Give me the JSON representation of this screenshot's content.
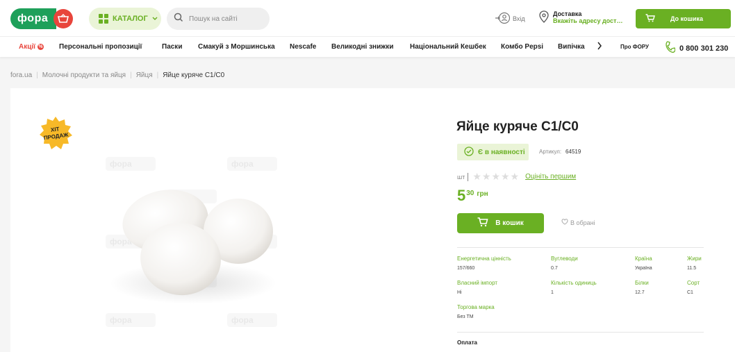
{
  "header": {
    "logo_text": "фора",
    "catalog_label": "КАТАЛОГ",
    "search_placeholder": "Пошук на сайті",
    "login_label": "Вхід",
    "delivery_title": "Доставка",
    "delivery_subtitle": "Вкажіть адресу доставки",
    "cart_label": "До кошика"
  },
  "nav": {
    "items": [
      "Акції",
      "Персональні пропозиції",
      "Паски",
      "Смакуй з Моршинська",
      "Nescafe",
      "Великодні знижки",
      "Національний Кешбек",
      "Комбо Pepsi",
      "Випічка"
    ],
    "about_label": "Про ФОРУ",
    "phone": "0 800 301 230"
  },
  "breadcrumb": [
    "fora.ua",
    "Молочні продукти та яйця",
    "Яйця",
    "Яйце куряче С1/С0"
  ],
  "product": {
    "badge": "ХІТ ПРОДАЖ",
    "watermark": "фора",
    "title": "Яйце куряче С1/С0",
    "stock_label": "Є в наявності",
    "article_label": "Артикул:",
    "article_value": "64519",
    "unit": "шт",
    "rating_stars": 0,
    "rate_link": "Оцініть першим",
    "price_main": "5",
    "price_cents": "30",
    "currency": "грн",
    "buy_label": "В кошик",
    "favorite_label": "В обрані",
    "properties": [
      {
        "key": "Енергетична цінність",
        "value": "157/660"
      },
      {
        "key": "Вуглеводи",
        "value": "0.7"
      },
      {
        "key": "Країна",
        "value": "Україна"
      },
      {
        "key": "Жири",
        "value": "11.5"
      },
      {
        "key": "Власний імпорт",
        "value": "Ні"
      },
      {
        "key": "Кількість одиниць",
        "value": "1"
      },
      {
        "key": "Білки",
        "value": "12.7"
      },
      {
        "key": "Сорт",
        "value": "С1"
      },
      {
        "key": "Торгова марка",
        "value": "Без ТМ"
      }
    ],
    "payment_label": "Оплата"
  },
  "colors": {
    "brand_green": "#1ea05a",
    "accent_green": "#6ab023",
    "accent_red": "#e8453c"
  }
}
